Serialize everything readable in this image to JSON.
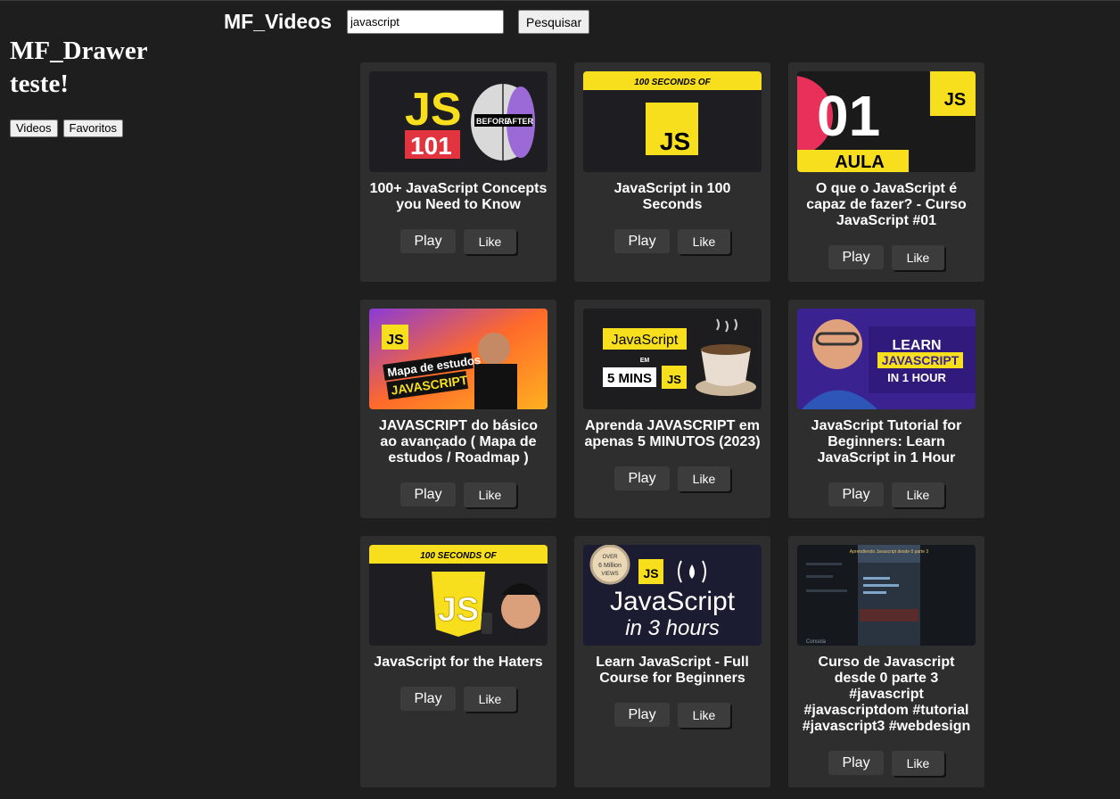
{
  "sidebar": {
    "title_line1": "MF_Drawer",
    "title_line2": "teste!",
    "nav": [
      "Videos",
      "Favoritos"
    ]
  },
  "header": {
    "app_title": "MF_Videos",
    "search_value": "javascript",
    "search_button": "Pesquisar"
  },
  "buttons": {
    "play": "Play",
    "like": "Like"
  },
  "videos": [
    {
      "title": "100+ JavaScript Concepts you Need to Know",
      "thumb": {
        "big": "JS",
        "tag": "101",
        "labels": [
          "BEFORE",
          "AFTER"
        ]
      }
    },
    {
      "title": "JavaScript in 100 Seconds",
      "thumb": {
        "banner": "100 SECONDS OF",
        "logo": "JS"
      }
    },
    {
      "title": "O que o JavaScript é capaz de fazer? - Curso JavaScript #01",
      "thumb": {
        "big": "01",
        "banner": "AULA",
        "logo": "JS"
      }
    },
    {
      "title": "JAVASCRIPT do básico ao avançado ( Mapa de estudos / Roadmap )",
      "thumb": {
        "logo": "JS",
        "line1": "Mapa de estudos",
        "line2": "JAVASCRIPT"
      }
    },
    {
      "title": "Aprenda JAVASCRIPT em apenas 5 MINUTOS (2023)",
      "thumb": {
        "label": "JavaScript",
        "em": "EM",
        "mins": "5 MINS",
        "logo": "JS"
      }
    },
    {
      "title": "JavaScript Tutorial for Beginners: Learn JavaScript in 1 Hour",
      "thumb": {
        "line1": "LEARN",
        "line2": "JAVASCRIPT",
        "line3": "IN 1 HOUR"
      }
    },
    {
      "title": "JavaScript for the Haters",
      "thumb": {
        "banner": "100 SECONDS OF",
        "logo": "JS"
      }
    },
    {
      "title": "Learn JavaScript - Full Course for Beginners",
      "thumb": {
        "badge1": "OVER",
        "badge2": "6 Million",
        "badge3": "VIEWS",
        "logo": "JS",
        "line1": "JavaScript",
        "line2": "in 3 hours"
      }
    },
    {
      "title": "Curso de Javascript desde 0 parte 3 #javascript #javascriptdom #tutorial #javascript3 #webdesign",
      "thumb": {
        "header": "Aprendiendo Javascript desde 0 parte 3",
        "footer": "Consola"
      }
    }
  ]
}
